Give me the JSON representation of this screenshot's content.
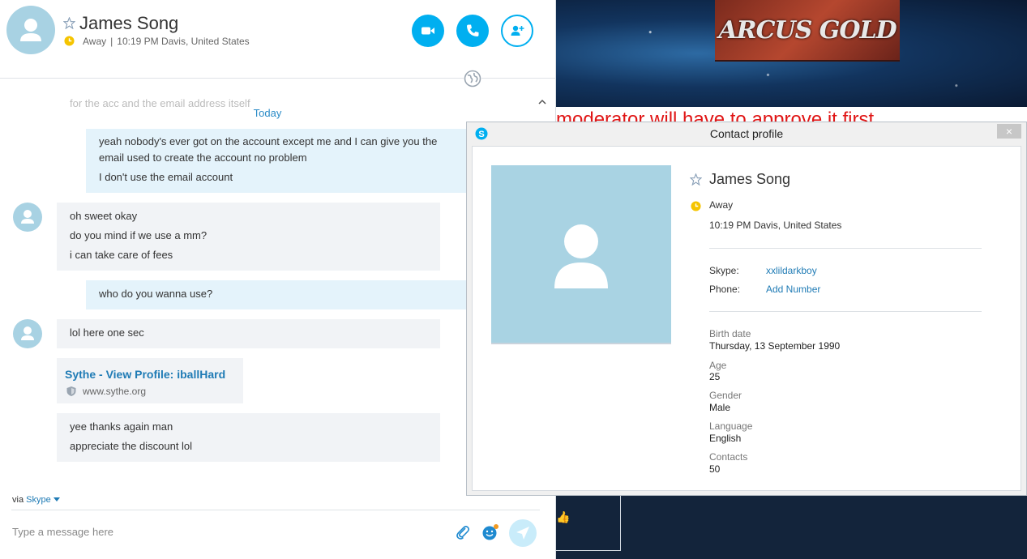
{
  "colors": {
    "accent": "#00aff0",
    "link": "#1f7bb5",
    "status_away": "#f5c400",
    "avatar_bg": "#a8d2e3"
  },
  "chat": {
    "header": {
      "name": "James Song",
      "status": "Away",
      "separator": "|",
      "local_time": "10:19 PM Davis, United States"
    },
    "faded_previous": "for the acc and the email address itself",
    "date_divider": "Today",
    "messages": [
      {
        "from": "me",
        "lines": [
          "yeah nobody's ever got on the account except me and I can give you the email used to create the account no problem",
          "I don't use the email account"
        ]
      },
      {
        "from": "them",
        "lines": [
          "oh sweet okay",
          "do you mind if we use a mm?",
          "i can take care of fees"
        ]
      },
      {
        "from": "me",
        "lines": [
          "who do you wanna use?"
        ]
      },
      {
        "from": "them",
        "lines": [
          "lol here one sec"
        ]
      },
      {
        "from": "them",
        "lines": [
          "yee thanks again man",
          "appreciate the discount lol"
        ]
      }
    ],
    "link_preview": {
      "title": "Sythe - View Profile: iballHard",
      "url": "www.sythe.org"
    },
    "via_label": "via",
    "via_link": "Skype",
    "compose_placeholder": "Type a message here"
  },
  "background": {
    "banner_text": "ARCUS GOLD",
    "red_text": "moderator will have to approve it first"
  },
  "profile": {
    "title": "Contact profile",
    "close_label": "×",
    "name": "James Song",
    "status": "Away",
    "local_time": "10:19 PM Davis, United States",
    "skype_label": "Skype:",
    "skype_value": "xxlildarkboy",
    "phone_label": "Phone:",
    "phone_value": "Add Number",
    "fields": [
      {
        "label": "Birth date",
        "value": "Thursday, 13 September 1990"
      },
      {
        "label": "Age",
        "value": "25"
      },
      {
        "label": "Gender",
        "value": "Male"
      },
      {
        "label": "Language",
        "value": "English"
      },
      {
        "label": "Contacts",
        "value": "50"
      }
    ]
  }
}
